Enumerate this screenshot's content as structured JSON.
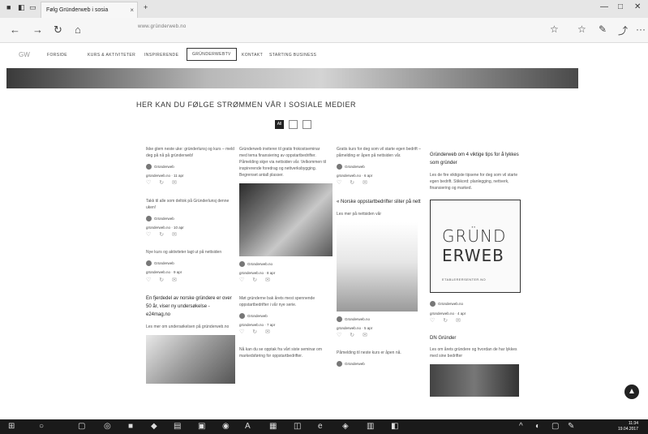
{
  "browser": {
    "tab_title": "Følg Gründerweb i sosia",
    "tab_close": "×",
    "url": "www.gründerweb.no",
    "nav": {
      "back": "←",
      "forward": "→",
      "refresh": "↻",
      "home": "⌂"
    },
    "toolbar": {
      "star": "☆",
      "favorites": "☆",
      "pen": "✎",
      "share": "⤴",
      "more": "···"
    },
    "window": {
      "minimize": "—",
      "maximize": "□",
      "close": "✕"
    }
  },
  "site": {
    "logo": "GW",
    "nav": [
      {
        "label": "FORSIDE"
      },
      {
        "label": "KURS & AKTIVITETER"
      },
      {
        "label": "INSPIRERENDE"
      },
      {
        "label": "GRÜNDERWEBTV"
      },
      {
        "label": "KONTAKT"
      },
      {
        "label": "STARTING BUSINESS"
      }
    ],
    "section_title": "HER KAN DU FØLGE STRØMMEN VÅR I SOSIALE MEDIER",
    "filters": [
      {
        "label": "All"
      },
      {
        "label": ""
      },
      {
        "label": ""
      }
    ]
  },
  "columns": [
    {
      "posts": [
        {
          "text": "Ikke glem neste uke: gründerlunsj og kurs – meld deg på nå på gründerweb!",
          "author": "Gründerweb",
          "time": "gründerweb.no · 11 apr"
        },
        {
          "text": "Takk til alle som deltok på Gründerlunsj denne uken!",
          "author": "Gründerweb",
          "time": "gründerweb.no · 10 apr"
        },
        {
          "text": "Nye kurs og aktiviteter lagt ut på nettsiden",
          "author": "Gründerweb",
          "time": "gründerweb.no · 9 apr"
        }
      ],
      "headline": "En fjerdedel av norske gründere er over 50 år, viser ny undersøkelse - e24mag.no",
      "headline_text": "Les mer om undersøkelsen på gründerweb.no"
    },
    {
      "top_text": "Gründerweb inviterer til gratis frokostseminar med tema finansiering av oppstartbedrifter. Påmelding skjer via nettsiden vår. Velkommen til inspirerende foredrag og nettverksbygging. Begrenset antall plasser.",
      "post1": {
        "author": "Gründerweb.no",
        "time": "gründerweb.no · 8 apr"
      },
      "post1_text": "Møt gründerne bak årets mest spennende oppstartbedrifter i vår nye serie.",
      "post2": {
        "author": "Gründerweb",
        "time": "gründerweb.no · 7 apr"
      },
      "post2_text": "Nå kan du se opptak fra vårt siste seminar om markedsføring for oppstartbedrifter."
    },
    {
      "top_text": "Gratis kurs for deg som vil starte egen bedrift – påmelding er åpen på nettsiden vår.",
      "post1": {
        "author": "Gründerweb",
        "time": "gründerweb.no · 6 apr"
      },
      "headline": "« Norske oppstartbedrifter sliter på nett",
      "headline_text": "Les mer på nettsiden vår",
      "post2": {
        "author": "Gründerweb.no",
        "time": "gründerweb.no · 5 apr"
      },
      "post2_text": "Påmelding til neste kurs er åpen nå.",
      "post3_author": "Gründerweb"
    },
    {
      "headline": "Gründerweb om 4 viktige tips for å lykkes som gründer",
      "headline_text": "Les de fire viktigste tipsene for deg som vil starte egen bedrift. Stikkord: planlegging, nettverk, finansiering og marked.",
      "logo_line1": "GRÜND",
      "logo_line2": "ERWEB",
      "logo_sub": "ETABLERERSENTER.NO",
      "post1": {
        "author": "Gründerweb.no",
        "time": "gründerweb.no · 4 apr"
      },
      "caption": "DN Gründer",
      "caption_text": "Les om årets gründere og hvordan de har lykkes med sine bedrifter"
    }
  ],
  "fab_icon": "▲",
  "taskbar": {
    "start": "⊞",
    "search": "○",
    "apps": [
      "▢",
      "◎",
      "■",
      "◆",
      "▤",
      "▣",
      "◉",
      "A",
      "▦",
      "◫",
      "e",
      "◈",
      "▥",
      "◧"
    ],
    "tray": [
      "^",
      "◐",
      "▢",
      "✎"
    ],
    "time": "11:34",
    "date": "19.04.2017"
  }
}
